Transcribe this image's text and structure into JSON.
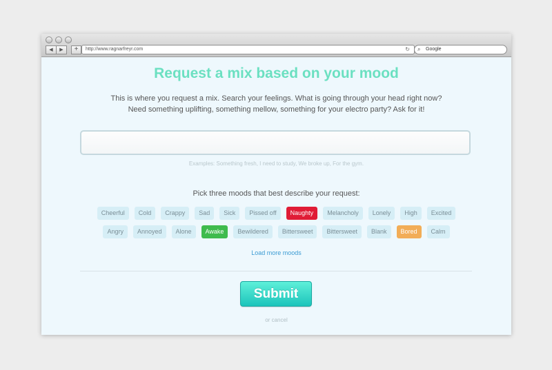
{
  "browser": {
    "url": "http://www.ragnarfreyr.com",
    "search_placeholder": "Google",
    "back_glyph": "◀",
    "forward_glyph": "▶",
    "add_glyph": "+",
    "reload_glyph": "↻",
    "search_glyph": "⌕"
  },
  "page": {
    "title": "Request a mix based on your mood",
    "intro_line1": "This is where you request a mix. Search your feelings. What is going through your head right now?",
    "intro_line2": "Need something uplifting, something mellow, something for your electro party? Ask for it!",
    "mood_input_value": "",
    "examples": "Examples: Something fresh, I need to study, We broke up, For the gym.",
    "pick_label": "Pick three moods that best describe your request:",
    "load_more": "Load more moods",
    "submit_label": "Submit",
    "cancel_label": "or cancel"
  },
  "moods_row1": [
    {
      "label": "Cheerful",
      "selected": false
    },
    {
      "label": "Cold",
      "selected": false
    },
    {
      "label": "Crappy",
      "selected": false
    },
    {
      "label": "Sad",
      "selected": false
    },
    {
      "label": "Sick",
      "selected": false
    },
    {
      "label": "Pissed off",
      "selected": false
    },
    {
      "label": "Naughty",
      "selected": true,
      "color": "#e01c36"
    },
    {
      "label": "Melancholy",
      "selected": false
    },
    {
      "label": "Lonely",
      "selected": false
    },
    {
      "label": "High",
      "selected": false
    },
    {
      "label": "Excited",
      "selected": false
    }
  ],
  "moods_row2": [
    {
      "label": "Angry",
      "selected": false
    },
    {
      "label": "Annoyed",
      "selected": false
    },
    {
      "label": "Alone",
      "selected": false
    },
    {
      "label": "Awake",
      "selected": true,
      "color": "#3fbb4d"
    },
    {
      "label": "Bewildered",
      "selected": false
    },
    {
      "label": "Bittersweet",
      "selected": false
    },
    {
      "label": "Bittersweet",
      "selected": false
    },
    {
      "label": "Blank",
      "selected": false
    },
    {
      "label": "Bored",
      "selected": true,
      "color": "#f2ad57"
    },
    {
      "label": "Calm",
      "selected": false
    }
  ],
  "colors": {
    "title": "#6be0c1",
    "tag_bg": "#d6eef6",
    "submit_top": "#5ef0d9",
    "submit_bottom": "#1cc4bb",
    "link": "#3b9bd3"
  }
}
